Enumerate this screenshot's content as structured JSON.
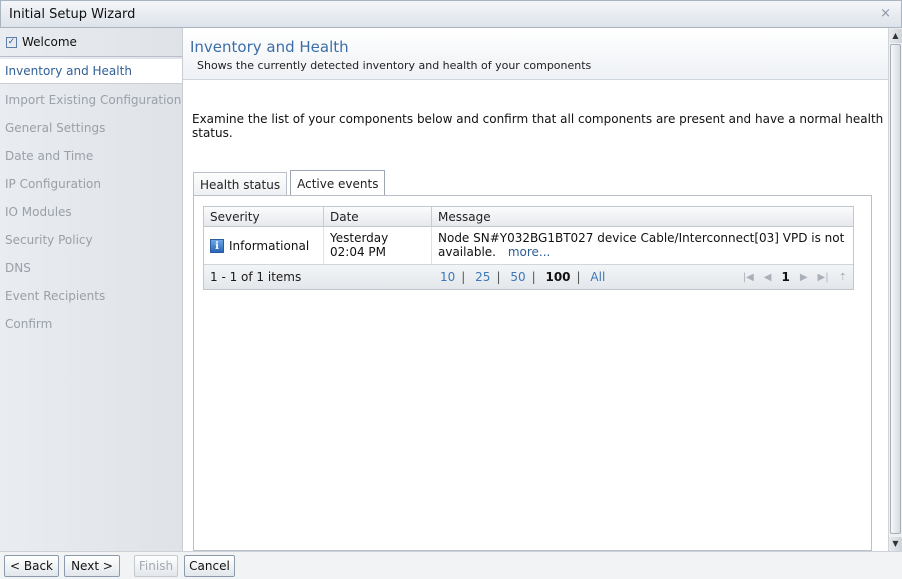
{
  "window": {
    "title": "Initial Setup Wizard",
    "close_glyph": "×"
  },
  "sidebar": {
    "welcome": "Welcome",
    "items": [
      {
        "label": "Inventory and Health"
      },
      {
        "label": "Import Existing Configuration"
      },
      {
        "label": "General Settings"
      },
      {
        "label": "Date and Time"
      },
      {
        "label": "IP Configuration"
      },
      {
        "label": "IO Modules"
      },
      {
        "label": "Security Policy"
      },
      {
        "label": "DNS"
      },
      {
        "label": "Event Recipients"
      },
      {
        "label": "Confirm"
      }
    ]
  },
  "header": {
    "title": "Inventory and Health",
    "subtitle": "Shows the currently detected inventory and health of your components"
  },
  "description": "Examine the list of your components below and confirm that all components are present and have a normal health status.",
  "tabs": [
    {
      "label": "Health status"
    },
    {
      "label": "Active events"
    }
  ],
  "grid": {
    "columns": {
      "severity": "Severity",
      "date": "Date",
      "message": "Message"
    },
    "rows": [
      {
        "severity": "Informational",
        "date": "Yesterday 02:04 PM",
        "message": "Node SN#Y032BG1BT027 device Cable/Interconnect[03] VPD is not available.",
        "more": "more..."
      }
    ],
    "footer": {
      "count": "1 - 1 of 1 items",
      "sizes": [
        "10",
        "25",
        "50",
        "100",
        "All"
      ],
      "current_page": "1"
    }
  },
  "buttons": {
    "back": "< Back",
    "next": "Next >",
    "finish": "Finish",
    "cancel": "Cancel"
  },
  "colors": {
    "accent": "#2f5f96",
    "header_title": "#3c6ea8"
  }
}
